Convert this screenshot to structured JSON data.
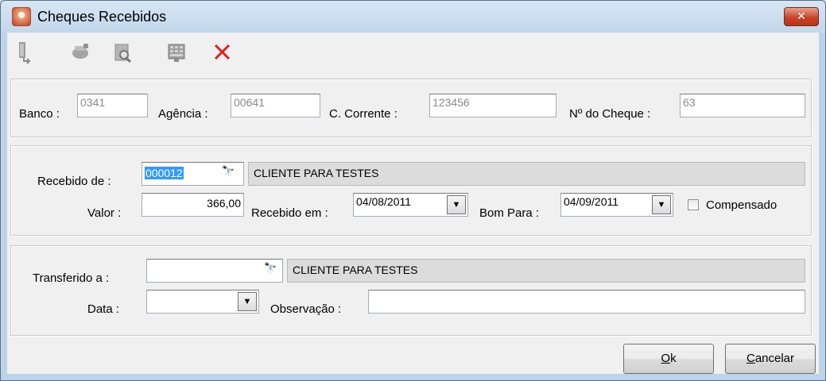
{
  "window": {
    "title": "Cheques Recebidos",
    "close_glyph": "✕"
  },
  "toolbar": {
    "buttons": [
      {
        "icon": "exit-door-icon"
      },
      {
        "icon": "hand-icon"
      },
      {
        "icon": "preview-icon"
      },
      {
        "icon": "keyboard-icon"
      },
      {
        "icon": "delete-x-icon"
      }
    ]
  },
  "cheque": {
    "banco_label": "Banco :",
    "banco_value": "0341",
    "agencia_label": "Agência :",
    "agencia_value": "00641",
    "conta_label": "C. Corrente :",
    "conta_value": "123456",
    "numero_label": "Nº do Cheque :",
    "numero_value": "63"
  },
  "recebimento": {
    "recebido_de_label": "Recebido de :",
    "recebido_de_code": "000012",
    "recebido_de_name": "CLIENTE PARA TESTES",
    "valor_label": "Valor :",
    "valor_value": "366,00",
    "recebido_em_label": "Recebido em :",
    "recebido_em_value": "04/08/2011",
    "bom_para_label": "Bom Para :",
    "bom_para_value": "04/09/2011",
    "compensado_label": "Compensado",
    "compensado_checked": false
  },
  "transferencia": {
    "transferido_label": "Transferido a :",
    "transferido_code": "",
    "transferido_name": "CLIENTE PARA TESTES",
    "data_label": "Data  :",
    "data_value": "",
    "observacao_label": "Observação :",
    "observacao_value": ""
  },
  "buttons": {
    "ok_mnemonic": "O",
    "ok_rest": "k",
    "cancel_mnemonic": "C",
    "cancel_rest": "ancelar"
  },
  "glyphs": {
    "binoculars": "🔭",
    "dropdown": "▼"
  }
}
